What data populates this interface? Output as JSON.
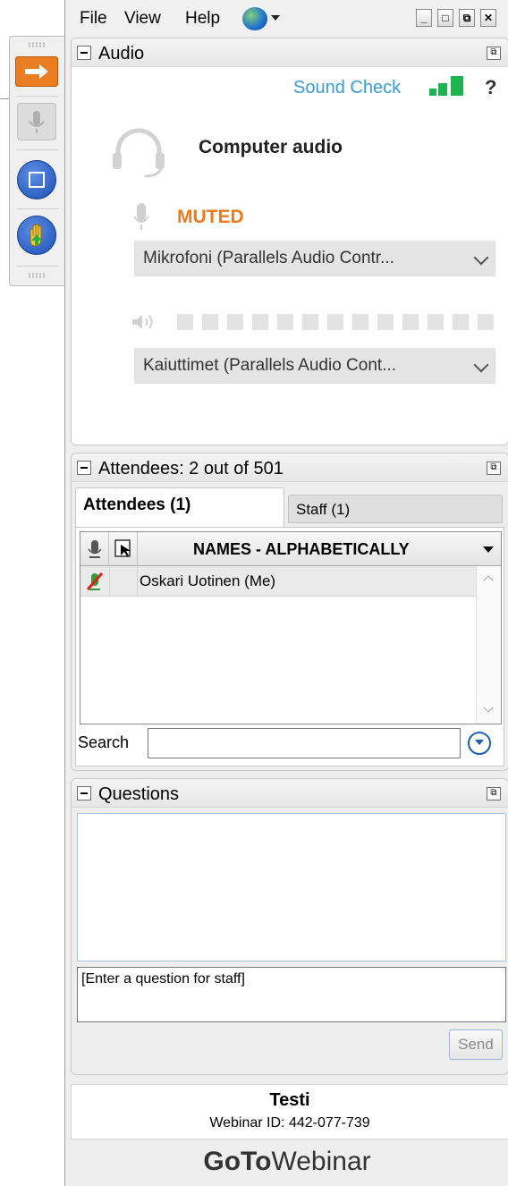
{
  "menu": {
    "file": "File",
    "view": "View",
    "help": "Help"
  },
  "window_buttons": {
    "minimize": "_",
    "maximize": "□",
    "restore": "⧉",
    "close": "✕"
  },
  "audio": {
    "title": "Audio",
    "sound_check": "Sound Check",
    "help": "?",
    "mode": "Computer audio",
    "status": "MUTED",
    "microphone": "Mikrofoni (Parallels Audio Contr...",
    "speakers": "Kaiuttimet (Parallels Audio Cont...",
    "signal_bars_active": 3,
    "speaker_level": 0
  },
  "attendees": {
    "title": "Attendees:  2 out of 501",
    "tab_attendees": "Attendees (1)",
    "tab_staff": "Staff (1)",
    "column_names": "NAMES - ALPHABETICALLY",
    "rows": [
      {
        "name": "Oskari Uotinen (Me)"
      }
    ],
    "search_label": "Search",
    "search_value": ""
  },
  "questions": {
    "title": "Questions",
    "input_placeholder": "[Enter a question for staff]",
    "send": "Send"
  },
  "footer": {
    "webinar_title": "Testi",
    "webinar_id": "Webinar ID: 442-077-739",
    "brand_bold": "GoTo",
    "brand_rest": "Webinar"
  },
  "colors": {
    "accent_orange": "#f07a1a",
    "link_blue": "#3a9bd8",
    "signal_green": "#1db34f"
  }
}
